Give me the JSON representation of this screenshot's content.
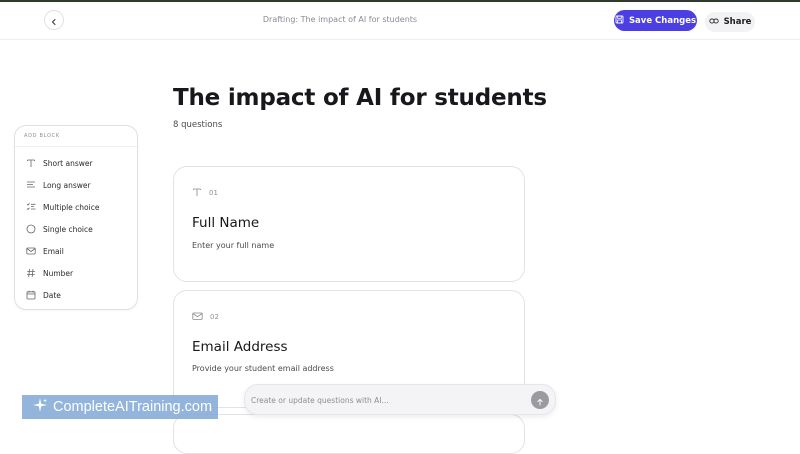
{
  "header": {
    "back_icon": "chevron-left-icon",
    "title": "Drafting: The impact of AI for students",
    "save_label": "Save Changes",
    "share_label": "Share"
  },
  "page": {
    "title": "The impact of AI for students",
    "subtitle": "8 questions"
  },
  "add_block": {
    "heading": "ADD BLOCK",
    "items": [
      {
        "label": "Short answer",
        "icon": "text-t-icon"
      },
      {
        "label": "Long answer",
        "icon": "paragraph-lines-icon"
      },
      {
        "label": "Multiple choice",
        "icon": "checklist-icon"
      },
      {
        "label": "Single choice",
        "icon": "circle-icon"
      },
      {
        "label": "Email",
        "icon": "envelope-icon"
      },
      {
        "label": "Number",
        "icon": "hash-icon"
      },
      {
        "label": "Date",
        "icon": "calendar-icon"
      }
    ]
  },
  "questions": [
    {
      "number": "01",
      "icon": "text-t-icon",
      "title": "Full Name",
      "description": "Enter your full name"
    },
    {
      "number": "02",
      "icon": "envelope-icon",
      "title": "Email Address",
      "description": "Provide your student email address"
    }
  ],
  "prompt": {
    "placeholder": "Create or update questions with AI..."
  },
  "watermark": {
    "text": "CompleteAITraining.com"
  },
  "colors": {
    "accent": "#4b3ee3",
    "watermark_bg": "#8aaed8"
  }
}
